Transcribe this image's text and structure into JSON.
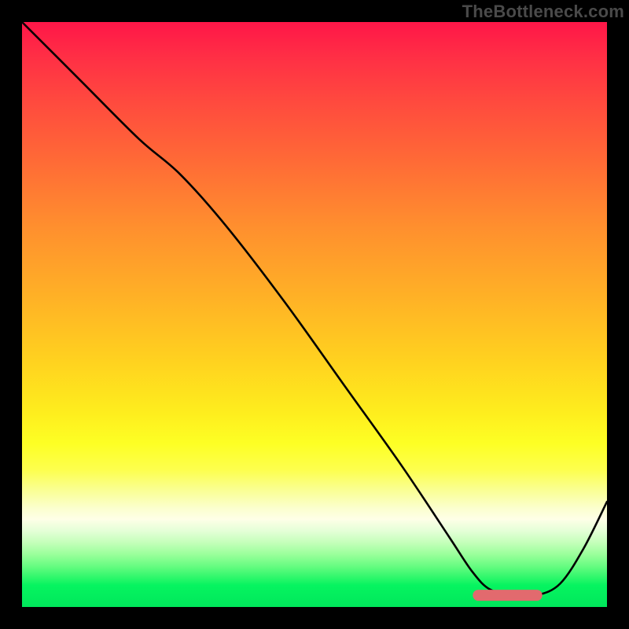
{
  "watermark": "TheBottleneck.com",
  "chart_data": {
    "type": "line",
    "title": "",
    "xlabel": "",
    "ylabel": "",
    "xlim": [
      0,
      100
    ],
    "ylim": [
      0,
      100
    ],
    "grid": false,
    "legend": false,
    "series": [
      {
        "name": "bottleneck-curve",
        "x": [
          0,
          10,
          20,
          27,
          35,
          45,
          55,
          65,
          73,
          77,
          80,
          84,
          88,
          92,
          96,
          100
        ],
        "y": [
          100,
          90,
          80,
          74,
          65,
          52,
          38,
          24,
          12,
          6,
          3,
          2,
          2,
          4,
          10,
          18
        ]
      }
    ],
    "marker": {
      "name": "optimal-range",
      "x_start": 78,
      "x_end": 88,
      "y": 2
    },
    "colors": {
      "curve": "#000000",
      "marker": "#e26a6e",
      "gradient_top": "#ff1648",
      "gradient_mid": "#ffd21f",
      "gradient_bottom": "#00e75b"
    }
  }
}
